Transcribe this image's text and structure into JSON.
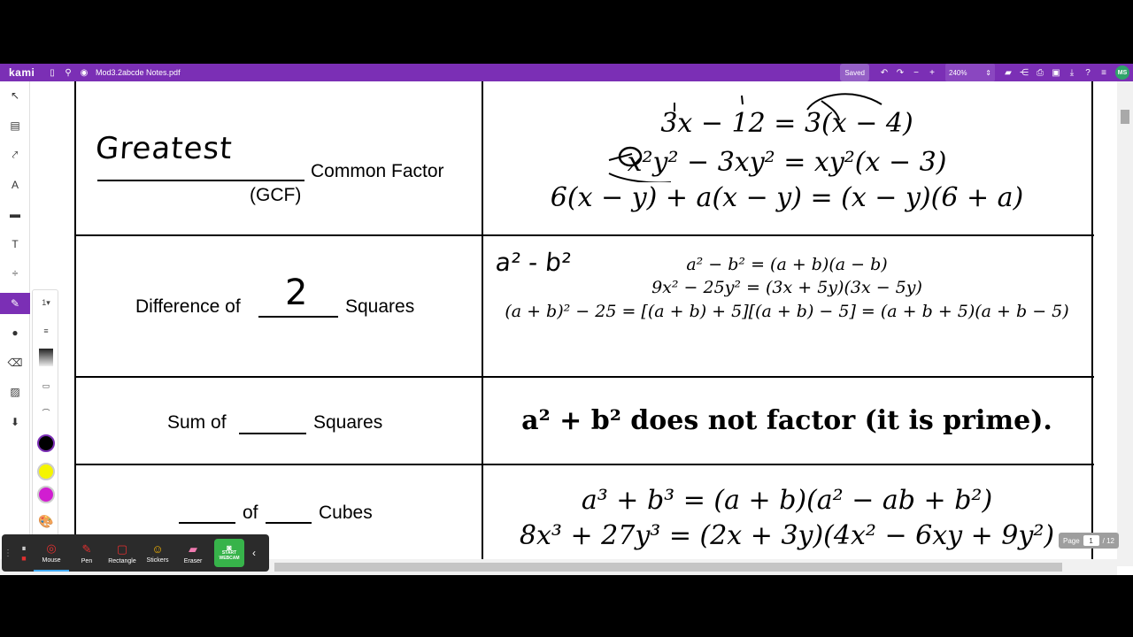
{
  "app": {
    "logo": "kami",
    "filename": "Mod3.2abcde Notes.pdf",
    "saved": "Saved",
    "zoom": "240%",
    "avatar": "MS"
  },
  "toolbar_icons": [
    "sidebar-icon",
    "search-icon",
    "globe-icon",
    "undo-icon",
    "redo-icon",
    "zoom-out-icon",
    "zoom-in-icon",
    "folder-icon",
    "share-icon",
    "print-icon",
    "save-icon",
    "download-icon",
    "help-icon",
    "menu-icon"
  ],
  "left_tools": [
    "select-icon",
    "book-icon",
    "comment-pointer-icon",
    "highlighter-icon",
    "comment-icon",
    "text-icon",
    "divide-icon",
    "pen-icon",
    "shapes-icon",
    "eraser-icon",
    "image-icon",
    "location-icon"
  ],
  "pen_options": {
    "size": "1",
    "colors": [
      "#000000",
      "#f5f500",
      "#d11ed1"
    ]
  },
  "rows": [
    {
      "left": {
        "handwriting": "Greatest",
        "label": "Common Factor",
        "sub": "(GCF)"
      },
      "right": [
        "3x − 12 = 3(x − 4)",
        "x²y² − 3xy² = xy²(x − 3)",
        "6(x − y) + a(x − y) = (x − y)(6 + a)"
      ]
    },
    {
      "left": {
        "prefix": "Difference of",
        "handwriting": "2",
        "suffix": "Squares"
      },
      "right_handwriting": "a² - b²",
      "right": [
        "a² − b² = (a + b)(a − b)",
        "9x² − 25y² = (3x + 5y)(3x − 5y)",
        "(a + b)² − 25 = [(a + b) + 5][(a + b) − 5] = (a + b + 5)(a + b − 5)"
      ]
    },
    {
      "left": {
        "prefix": "Sum of",
        "suffix": "Squares"
      },
      "right": [
        "a² + b² does not factor (it is prime)."
      ]
    },
    {
      "left": {
        "middle": "of",
        "suffix": "Cubes"
      },
      "right": [
        "a³ + b³ = (a + b)(a² − ab + b²)",
        "8x³ + 27y³ = (2x + 3y)(4x² − 6xy + 9y²)"
      ]
    }
  ],
  "page": {
    "label": "Page",
    "current": "1",
    "total": "/ 12"
  },
  "recorder": {
    "mouse": "Mouse",
    "pen": "Pen",
    "rectangle": "Rectangle",
    "stickers": "Stickers",
    "eraser": "Eraser",
    "webcam": "START WEBCAM"
  }
}
